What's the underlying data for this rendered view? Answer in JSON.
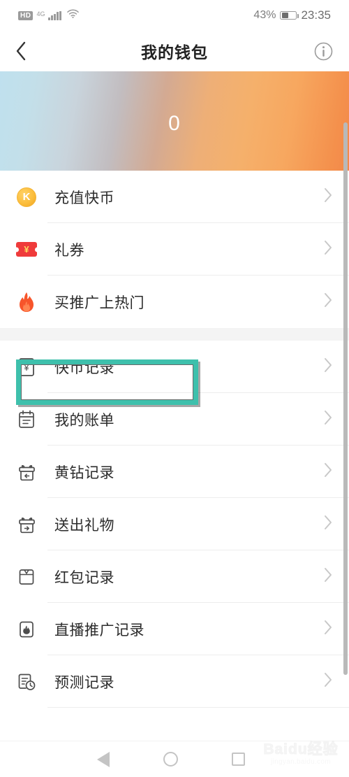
{
  "status_bar": {
    "hd_badge": "HD",
    "network": "4G",
    "signal_icon": "signal-bars-icon",
    "wifi_icon": "wifi-icon",
    "battery_percent": "43%",
    "battery_level": 43,
    "battery_icon": "battery-icon",
    "time": "23:35"
  },
  "header": {
    "back_icon": "back-chevron-icon",
    "title": "我的钱包",
    "info_icon": "info-circle-icon"
  },
  "banner": {
    "amount": "0",
    "gradient_from": "#bfe0ee",
    "gradient_to": "#f2884a"
  },
  "groups": [
    {
      "items": [
        {
          "label": "充值快币",
          "icon": "kuaibi-coin-icon",
          "chevron": "chevron-right-icon"
        },
        {
          "label": "礼券",
          "icon": "gift-coupon-ticket-icon",
          "chevron": "chevron-right-icon"
        },
        {
          "label": "买推广上热门",
          "icon": "flame-icon",
          "chevron": "chevron-right-icon"
        }
      ]
    },
    {
      "items": [
        {
          "label": "快币记录",
          "icon": "kuaibi-record-document-icon",
          "chevron": "chevron-right-icon",
          "highlighted": true
        },
        {
          "label": "我的账单",
          "icon": "calendar-bill-icon",
          "chevron": "chevron-right-icon"
        },
        {
          "label": "黄钻记录",
          "icon": "gift-box-receive-icon",
          "chevron": "chevron-right-icon"
        },
        {
          "label": "送出礼物",
          "icon": "gift-box-send-icon",
          "chevron": "chevron-right-icon"
        },
        {
          "label": "红包记录",
          "icon": "red-packet-envelope-icon",
          "chevron": "chevron-right-icon"
        },
        {
          "label": "直播推广记录",
          "icon": "live-promotion-flame-icon",
          "chevron": "chevron-right-icon"
        },
        {
          "label": "预测记录",
          "icon": "prediction-clock-document-icon",
          "chevron": "chevron-right-icon"
        }
      ]
    }
  ],
  "highlight": {
    "color": "#3ec0ac",
    "target_label": "快币记录"
  },
  "nav_bar": {
    "back_icon": "nav-back-triangle-icon",
    "home_icon": "nav-home-circle-icon",
    "recents_icon": "nav-recents-square-icon"
  },
  "watermark": {
    "main": "Baidu经验",
    "sub": "jingyan.baidu.com"
  }
}
